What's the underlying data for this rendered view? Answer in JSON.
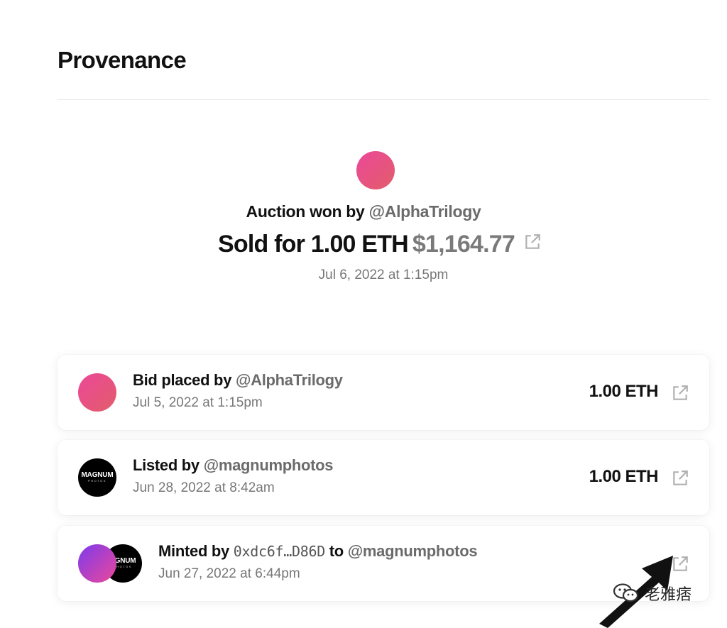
{
  "section": {
    "title": "Provenance"
  },
  "hero": {
    "prefix": "Auction won by",
    "user": "@AlphaTrilogy",
    "sold_prefix": "Sold for 1.00 ETH",
    "usd": "$1,164.77",
    "date": "Jul 6, 2022 at 1:15pm",
    "link_icon": "external-link-icon"
  },
  "events": [
    {
      "action": "Bid placed by",
      "user": "@AlphaTrilogy",
      "date": "Jul 5, 2022 at 1:15pm",
      "amount": "1.00 ETH"
    },
    {
      "action": "Listed by",
      "user": "@magnumphotos",
      "date": "Jun 28, 2022 at 8:42am",
      "amount": "1.00 ETH",
      "avatar_text": "MAGNUM",
      "avatar_subtext": "PHOTOS"
    },
    {
      "action": "Minted by",
      "address": "0xdc6f…D86D",
      "to": "to",
      "user": "@magnumphotos",
      "date": "Jun 27, 2022 at 6:44pm",
      "avatar_text": "AGNUM",
      "avatar_subtext": "PHOTOS"
    }
  ],
  "watermark": {
    "text": "老雅痞"
  },
  "colors": {
    "accent_pink": "#ec4899",
    "accent_purple": "#7c3aed",
    "muted": "#777777"
  }
}
